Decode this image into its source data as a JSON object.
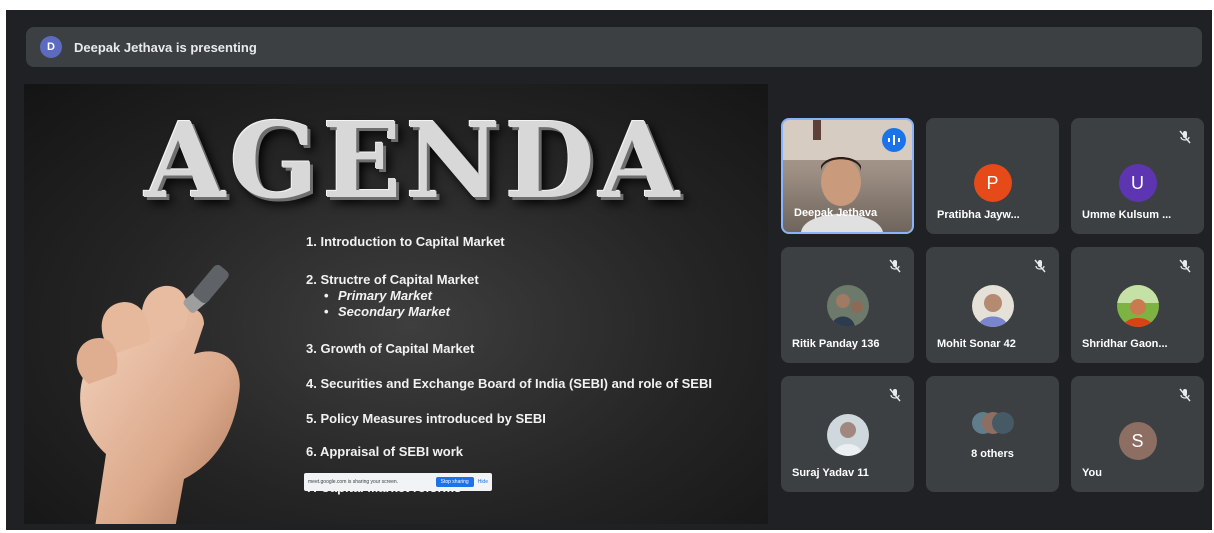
{
  "banner": {
    "avatar_letter": "D",
    "title": "Deepak Jethava is presenting"
  },
  "slide": {
    "heading": "AGENDA",
    "items": [
      "1.  Introduction to Capital Market",
      "2. Structre of Capital Market",
      "3. Growth of Capital Market",
      "4. Securities and Exchange Board of India (SEBI) and role of SEBI",
      "5. Policy Measures introduced by SEBI",
      "6. Appraisal of SEBI work",
      "7. Capital Market reforms"
    ],
    "sub_items": [
      "Primary Market",
      "Secondary Market"
    ]
  },
  "sharebar": {
    "message": "meet.google.com is sharing your screen.",
    "stop_label": "Stop sharing",
    "hide_label": "Hide"
  },
  "participants": [
    {
      "name": "Deepak Jethava",
      "type": "video"
    },
    {
      "name": "Pratibha Jayw...",
      "letter": "P",
      "color": "#e64a19"
    },
    {
      "name": "Umme Kulsum ...",
      "letter": "U",
      "color": "#5e35b1"
    },
    {
      "name": "Ritik Panday 136",
      "type": "photo"
    },
    {
      "name": "Mohit Sonar 42",
      "type": "photo"
    },
    {
      "name": "Shridhar Gaon...",
      "type": "photo"
    },
    {
      "name": "Suraj Yadav 11",
      "type": "photo"
    },
    {
      "name": "8 others",
      "type": "group"
    },
    {
      "name": "You",
      "letter": "S",
      "color": "#8d6e63"
    }
  ],
  "colors": {
    "background": "#202124",
    "tile": "#3c4043",
    "accent_blue": "#1a73e8",
    "presenter_border": "#8ab4f8"
  },
  "icons": {
    "mute": "mic-off-icon",
    "speaking": "audio-wave-icon"
  }
}
